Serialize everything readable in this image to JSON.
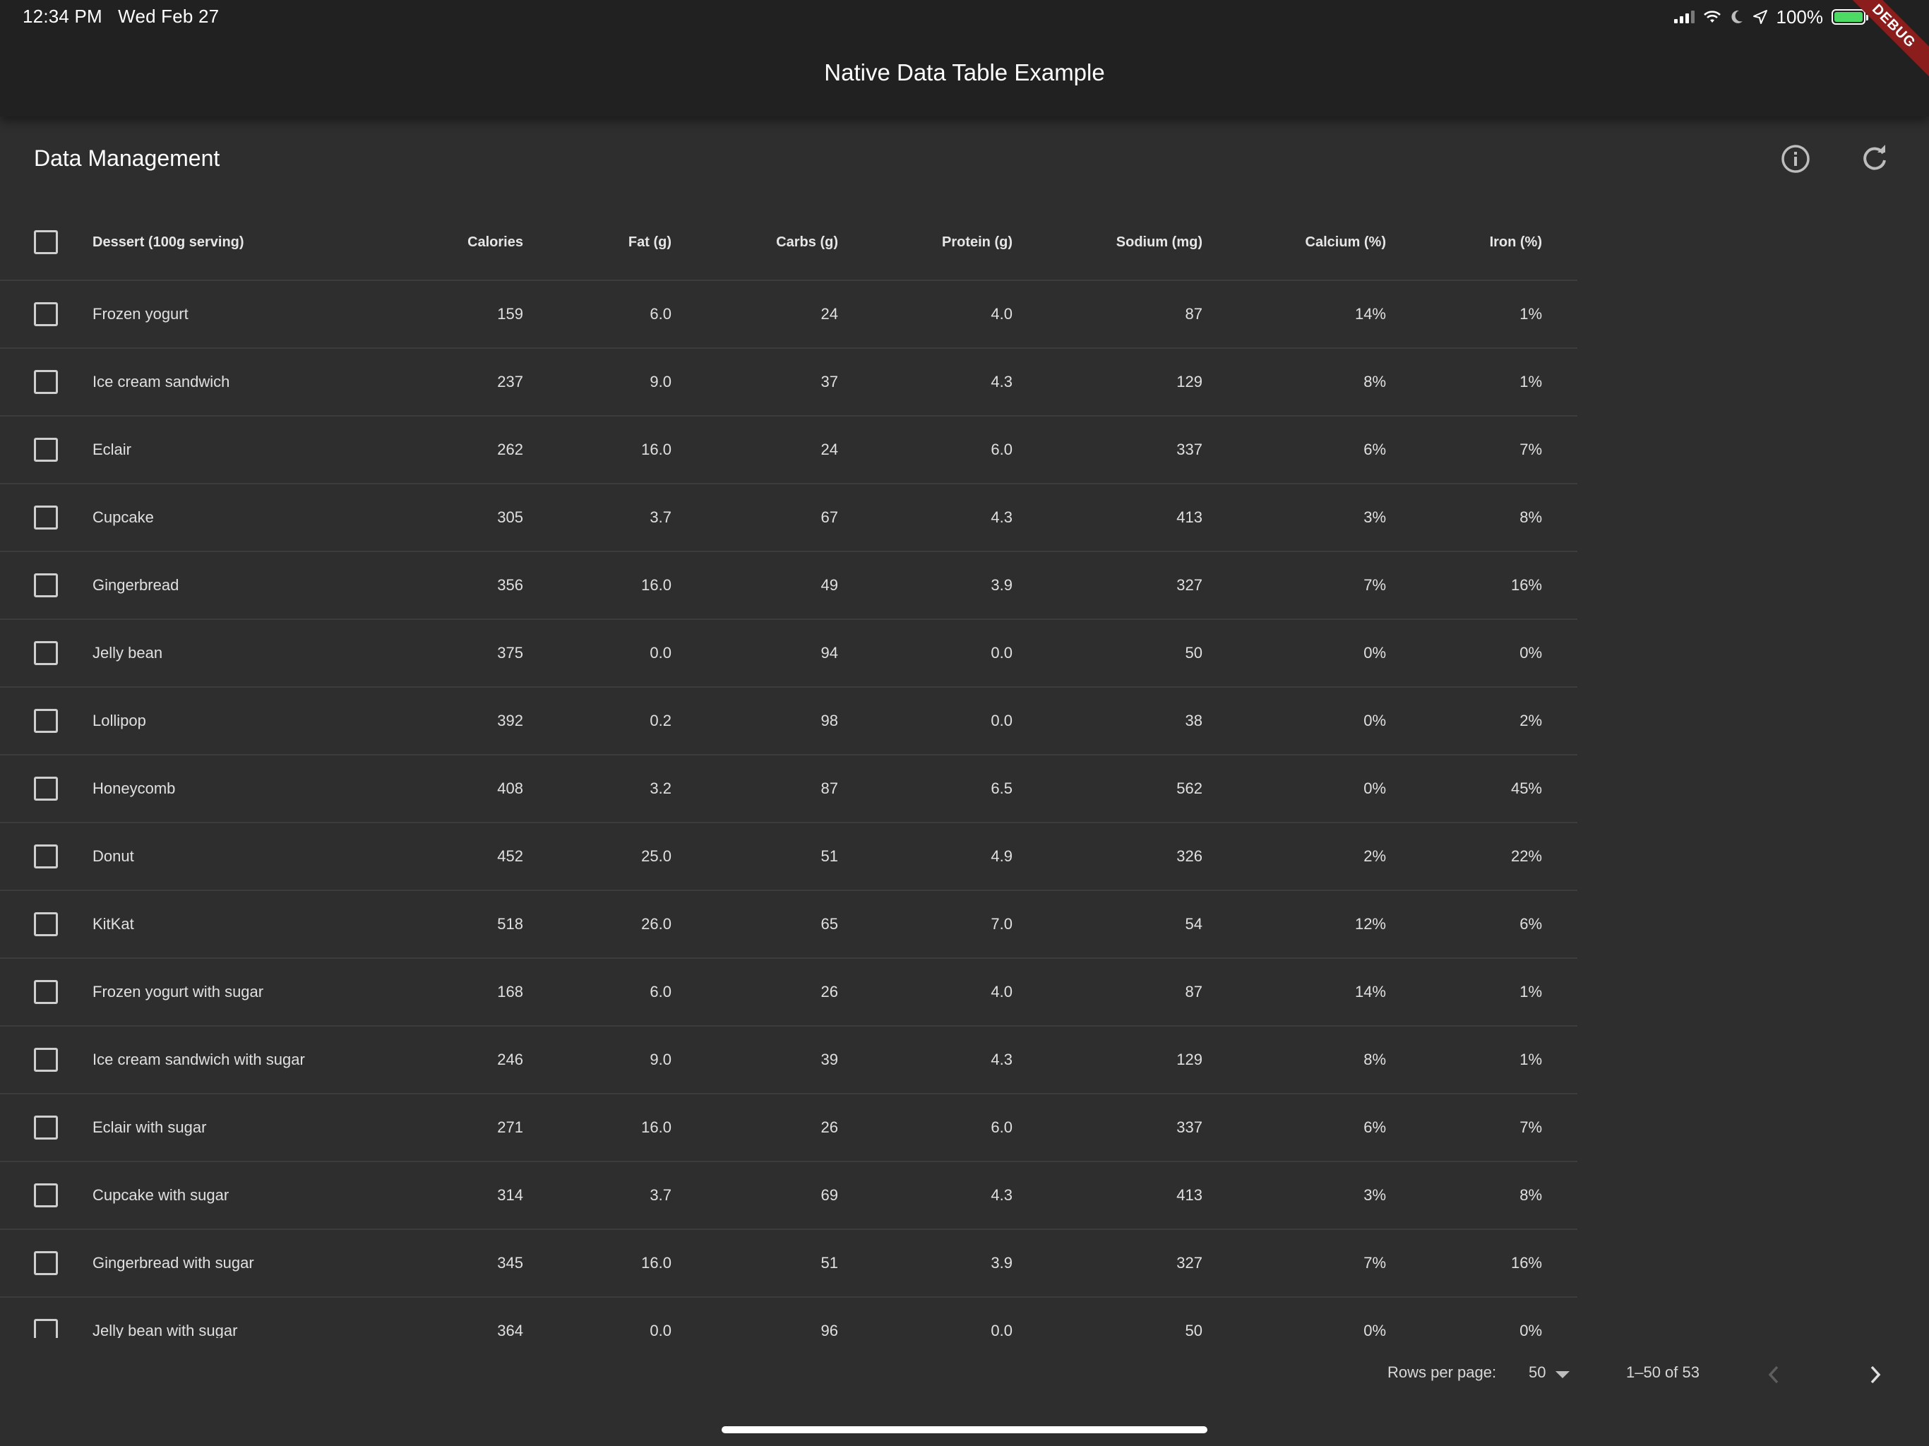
{
  "status_bar": {
    "time": "12:34 PM",
    "date": "Wed Feb 27",
    "battery": "100%",
    "debug": "DEBUG"
  },
  "app_bar": {
    "title": "Native Data Table Example"
  },
  "card": {
    "title": "Data Management",
    "info_icon": "info-icon",
    "refresh_icon": "refresh-icon"
  },
  "table": {
    "columns": [
      "Dessert (100g serving)",
      "Calories",
      "Fat (g)",
      "Carbs (g)",
      "Protein (g)",
      "Sodium (mg)",
      "Calcium (%)",
      "Iron (%)"
    ],
    "rows": [
      [
        "Frozen yogurt",
        "159",
        "6.0",
        "24",
        "4.0",
        "87",
        "14%",
        "1%"
      ],
      [
        "Ice cream sandwich",
        "237",
        "9.0",
        "37",
        "4.3",
        "129",
        "8%",
        "1%"
      ],
      [
        "Eclair",
        "262",
        "16.0",
        "24",
        "6.0",
        "337",
        "6%",
        "7%"
      ],
      [
        "Cupcake",
        "305",
        "3.7",
        "67",
        "4.3",
        "413",
        "3%",
        "8%"
      ],
      [
        "Gingerbread",
        "356",
        "16.0",
        "49",
        "3.9",
        "327",
        "7%",
        "16%"
      ],
      [
        "Jelly bean",
        "375",
        "0.0",
        "94",
        "0.0",
        "50",
        "0%",
        "0%"
      ],
      [
        "Lollipop",
        "392",
        "0.2",
        "98",
        "0.0",
        "38",
        "0%",
        "2%"
      ],
      [
        "Honeycomb",
        "408",
        "3.2",
        "87",
        "6.5",
        "562",
        "0%",
        "45%"
      ],
      [
        "Donut",
        "452",
        "25.0",
        "51",
        "4.9",
        "326",
        "2%",
        "22%"
      ],
      [
        "KitKat",
        "518",
        "26.0",
        "65",
        "7.0",
        "54",
        "12%",
        "6%"
      ],
      [
        "Frozen yogurt with sugar",
        "168",
        "6.0",
        "26",
        "4.0",
        "87",
        "14%",
        "1%"
      ],
      [
        "Ice cream sandwich with sugar",
        "246",
        "9.0",
        "39",
        "4.3",
        "129",
        "8%",
        "1%"
      ],
      [
        "Eclair with sugar",
        "271",
        "16.0",
        "26",
        "6.0",
        "337",
        "6%",
        "7%"
      ],
      [
        "Cupcake with sugar",
        "314",
        "3.7",
        "69",
        "4.3",
        "413",
        "3%",
        "8%"
      ],
      [
        "Gingerbread with sugar",
        "345",
        "16.0",
        "51",
        "3.9",
        "327",
        "7%",
        "16%"
      ],
      [
        "Jelly bean with sugar",
        "364",
        "0.0",
        "96",
        "0.0",
        "50",
        "0%",
        "0%"
      ]
    ]
  },
  "footer": {
    "rows_per_page_label": "Rows per page:",
    "rows_per_page_value": "50",
    "range": "1–50 of 53"
  },
  "colors": {
    "background": "#2e2e2e",
    "app_bar": "#212121",
    "divider": "#3d3d3d",
    "battery_fill": "#4cd964",
    "debug_banner": "#8b1d1d"
  }
}
